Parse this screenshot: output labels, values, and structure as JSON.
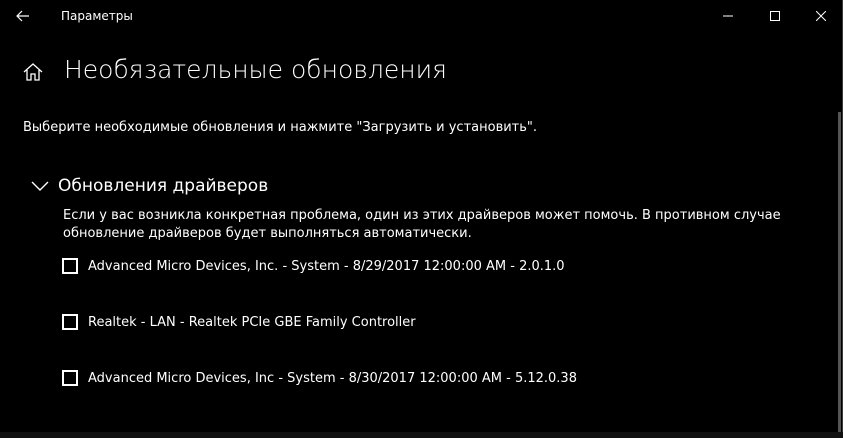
{
  "window": {
    "title": "Параметры"
  },
  "header": {
    "page_title": "Необязательные обновления"
  },
  "intro_text": "Выберите необходимые обновления и нажмите \"Загрузить и установить\".",
  "section": {
    "title": "Обновления драйверов",
    "description": "Если у вас возникла конкретная проблема, один из этих драйверов может помочь. В противном случае обновление драйверов будет выполняться автоматически.",
    "items": [
      {
        "label": "Advanced Micro Devices, Inc. - System - 8/29/2017 12:00:00 AM - 2.0.1.0",
        "checked": false
      },
      {
        "label": "Realtek - LAN - Realtek PCIe GBE Family Controller",
        "checked": false
      },
      {
        "label": "Advanced Micro Devices, Inc - System - 8/30/2017 12:00:00 AM - 5.12.0.38",
        "checked": false
      }
    ]
  },
  "icons": {
    "back": "back-arrow-icon",
    "minimize": "minimize-icon",
    "maximize": "maximize-icon",
    "close": "close-icon",
    "home": "home-icon",
    "chevron": "chevron-down-icon"
  },
  "colors": {
    "background": "#000000",
    "text": "#ffffff"
  }
}
